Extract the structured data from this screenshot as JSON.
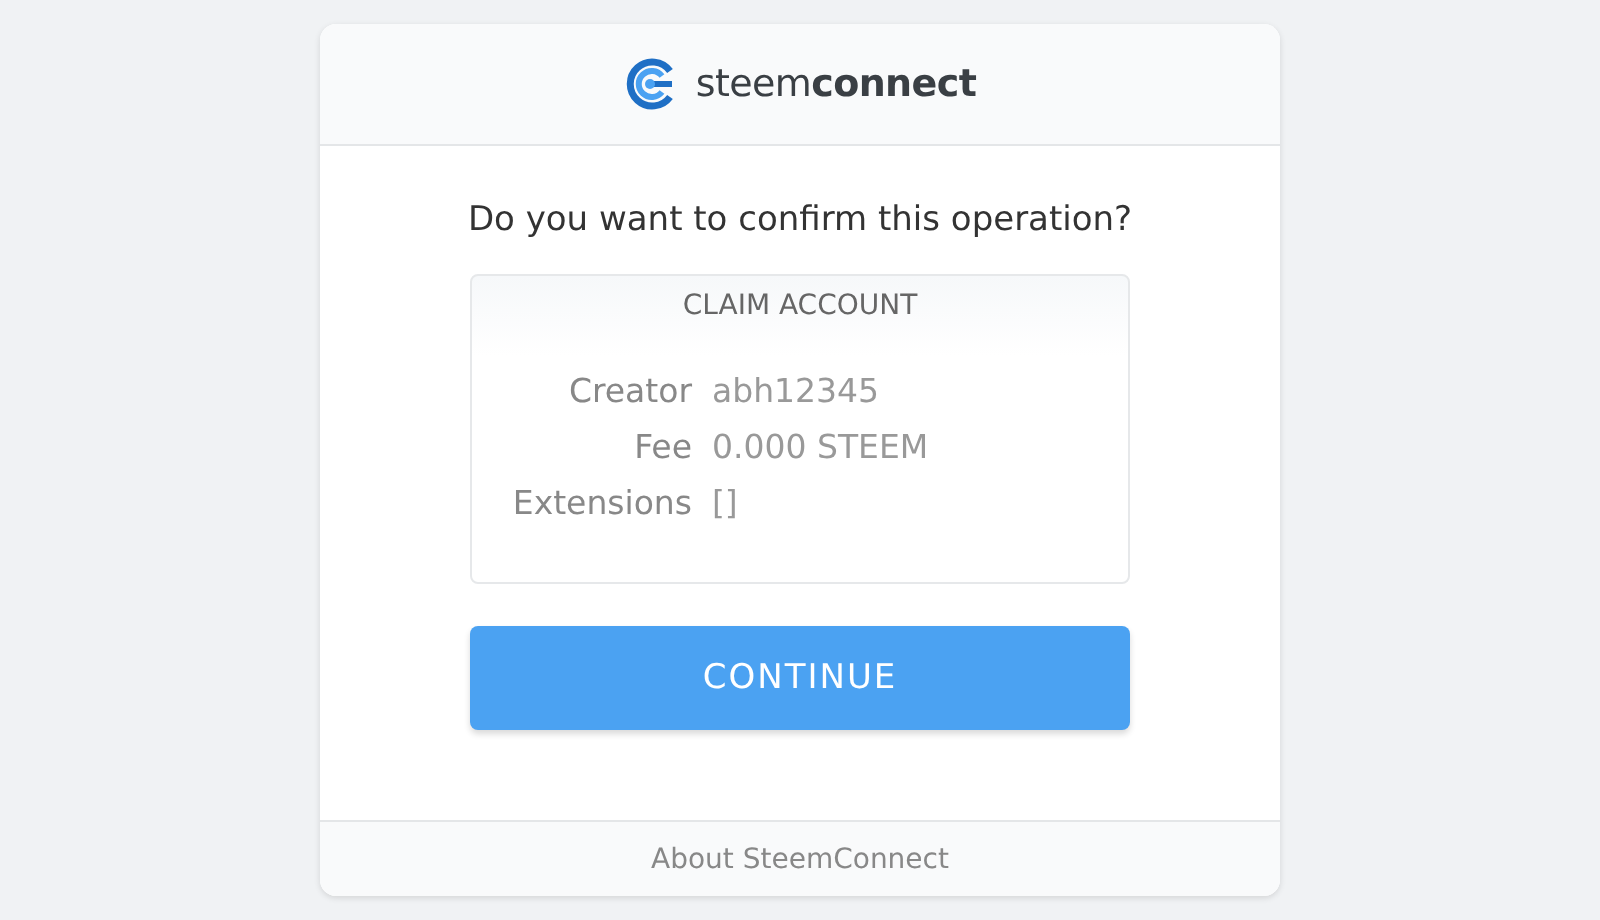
{
  "brand": {
    "wordmark": "steem**connect**"
  },
  "question": "Do you want to confirm this operation?",
  "operation": {
    "title": "CLAIM ACCOUNT",
    "fields": [
      {
        "label": "Creator",
        "value": "abh12345"
      },
      {
        "label": "Fee",
        "value": "0.000 STEEM"
      },
      {
        "label": "Extensions",
        "value": "[]"
      }
    ]
  },
  "button": "CONTINUE",
  "footer": "About SteemConnect"
}
